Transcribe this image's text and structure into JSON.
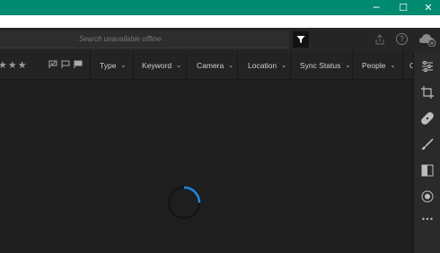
{
  "window": {
    "minimize_glyph": "─",
    "maximize_glyph": "☐",
    "close_glyph": "✕",
    "title_color": "#008a70"
  },
  "search": {
    "placeholder": "Search unavailable offline"
  },
  "header": {
    "help_glyph": "?"
  },
  "filters": {
    "stars": "★★★",
    "items": [
      {
        "label": "Type"
      },
      {
        "label": "Keyword"
      },
      {
        "label": "Camera"
      },
      {
        "label": "Location"
      },
      {
        "label": "Sync Status"
      },
      {
        "label": "People"
      }
    ],
    "chevron": "⌄"
  },
  "right_panel": {
    "icons": [
      "sliders-icon",
      "crop-icon",
      "healing-bandage-icon",
      "brush-icon",
      "gradient-icon",
      "radial-icon",
      "more-icon"
    ]
  },
  "colors": {
    "accent": "#1a8ce8",
    "background": "#1e1e1e"
  }
}
